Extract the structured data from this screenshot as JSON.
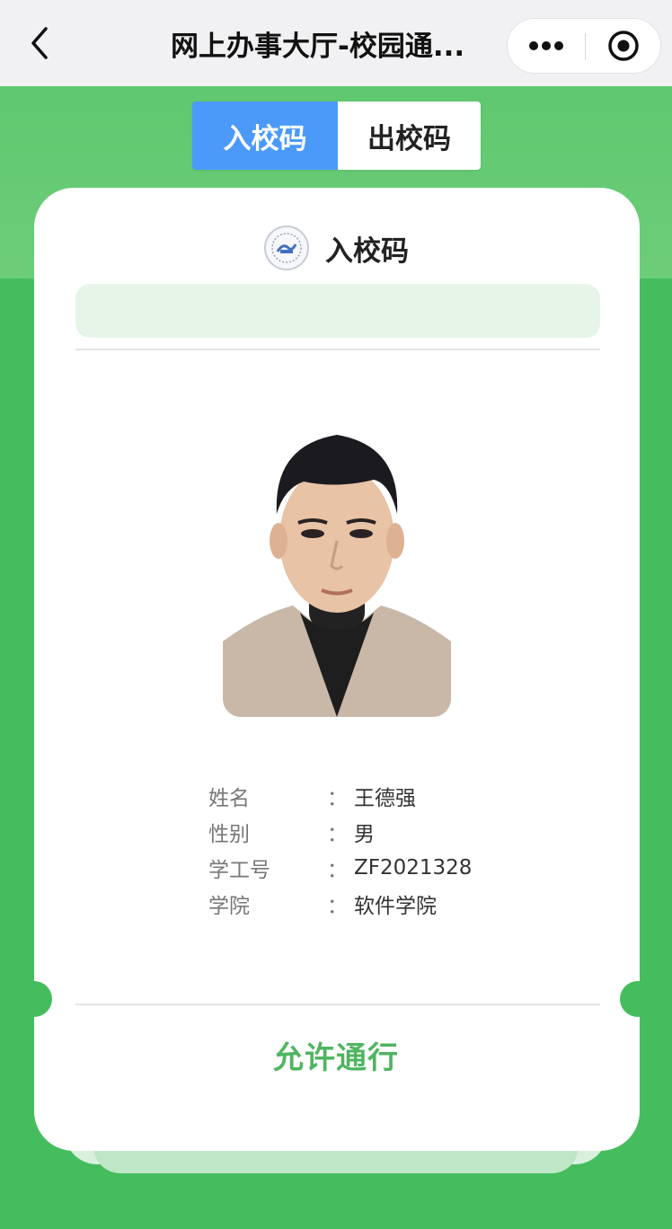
{
  "navbar": {
    "title": "网上办事大厅-校园通..."
  },
  "tabs": [
    {
      "label": "入校码",
      "active": true
    },
    {
      "label": "出校码",
      "active": false
    }
  ],
  "card": {
    "title": "入校码",
    "fields": [
      {
        "label": "姓名",
        "value": "王德强"
      },
      {
        "label": "性别",
        "value": "男"
      },
      {
        "label": "学工号",
        "value": "ZF2021328"
      },
      {
        "label": "学院",
        "value": "软件学院"
      }
    ],
    "colon": "：",
    "status": "允许通行"
  },
  "icons": {
    "back": "chevron-left-icon",
    "more": "more-dots-icon",
    "close": "target-circle-icon",
    "logo": "school-logo-icon"
  },
  "colors": {
    "background_green": "#45bd5e",
    "active_tab": "#4b9afa",
    "status_green": "#4fb560"
  }
}
